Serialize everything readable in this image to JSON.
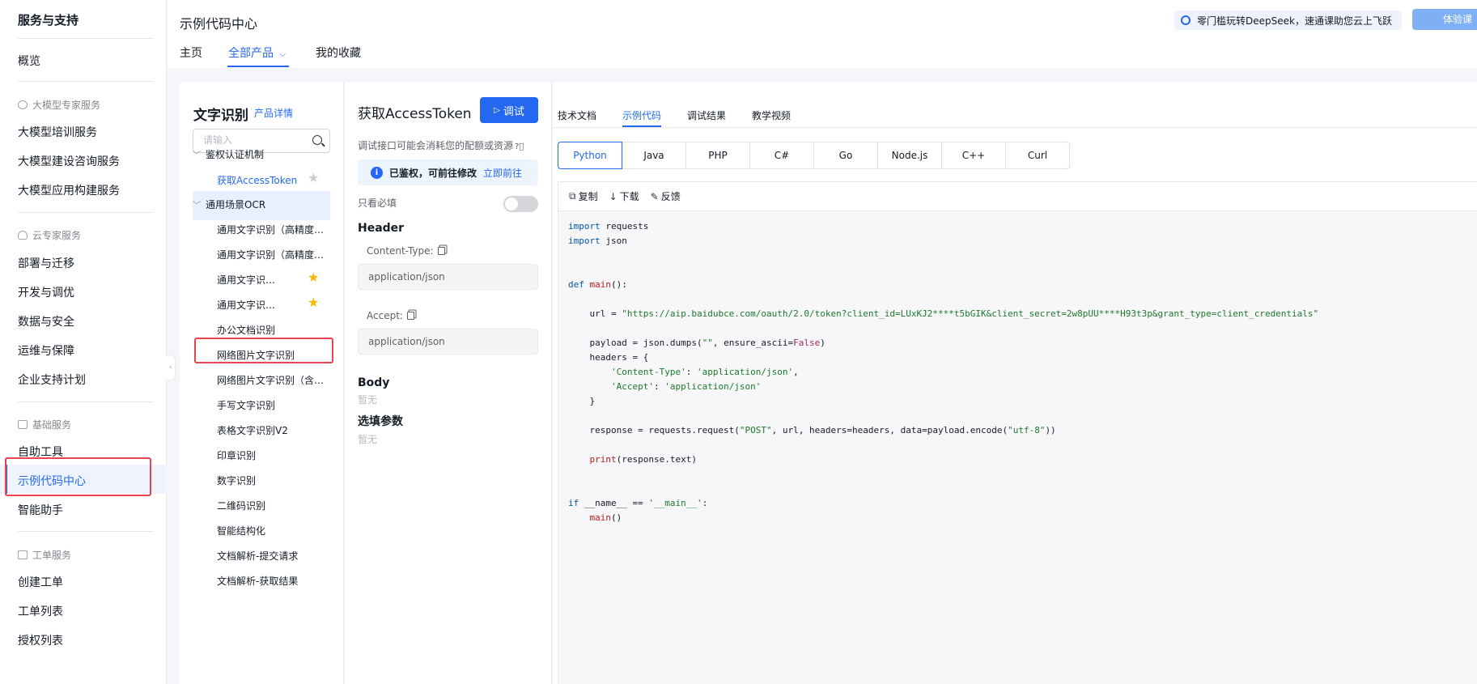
{
  "sidebar": {
    "title": "服务与支持",
    "overview": "概览",
    "groups": [
      {
        "label": "大模型专家服务",
        "items": [
          "大模型培训服务",
          "大模型建设咨询服务",
          "大模型应用构建服务"
        ]
      },
      {
        "label": "云专家服务",
        "items": [
          "部署与迁移",
          "开发与调优",
          "数据与安全",
          "运维与保障",
          "企业支持计划"
        ]
      },
      {
        "label": "基础服务",
        "items": [
          "自助工具",
          "示例代码中心",
          "智能助手"
        ]
      },
      {
        "label": "工单服务",
        "items": [
          "创建工单",
          "工单列表",
          "授权列表"
        ]
      }
    ],
    "active_item": "示例代码中心"
  },
  "header": {
    "title": "示例代码中心",
    "tabs": [
      "主页",
      "全部产品",
      "我的收藏"
    ],
    "active_tab": "全部产品",
    "promo": "零门槛玩转DeepSeek，速通课助您云上飞跃",
    "try_button": "体验课"
  },
  "product": {
    "title": "文字识别",
    "details_link": "产品详情",
    "search_placeholder": "请输入",
    "sections": [
      {
        "label": "鉴权认证机制",
        "items": [
          {
            "label": "获取AccessToken",
            "selected": true,
            "star": "off"
          }
        ]
      },
      {
        "label": "通用场景OCR",
        "items": [
          {
            "label": "通用文字识别（高精度含位置版）"
          },
          {
            "label": "通用文字识别（高精度版）"
          },
          {
            "label": "通用文字识别（标准含位置版）",
            "star": "on"
          },
          {
            "label": "通用文字识别（标准版）",
            "star": "on"
          },
          {
            "label": "办公文档识别"
          },
          {
            "label": "网络图片文字识别"
          },
          {
            "label": "网络图片文字识别（含位置版）"
          },
          {
            "label": "手写文字识别"
          },
          {
            "label": "表格文字识别V2"
          },
          {
            "label": "印章识别"
          },
          {
            "label": "数字识别"
          },
          {
            "label": "二维码识别"
          },
          {
            "label": "智能结构化"
          },
          {
            "label": "文档解析-提交请求"
          },
          {
            "label": "文档解析-获取结果"
          }
        ]
      }
    ]
  },
  "api": {
    "title": "获取AccessToken",
    "debug_button": "调试",
    "note": "调试接口可能会消耗您的配额或资源",
    "alert_text": "已鉴权，可前往修改",
    "alert_link": "立即前往",
    "required_only": "只看必填",
    "header_section": "Header",
    "fields": [
      {
        "label": "Content-Type:",
        "value": "application/json"
      },
      {
        "label": "Accept:",
        "value": "application/json"
      }
    ],
    "body_section": "Body",
    "body_empty": "暂无",
    "optional_section": "选填参数",
    "optional_empty": "暂无"
  },
  "code_panel": {
    "tabs": [
      "技术文档",
      "示例代码",
      "调试结果",
      "教学视频"
    ],
    "active_tab": "示例代码",
    "languages": [
      "Python",
      "Java",
      "PHP",
      "C#",
      "Go",
      "Node.js",
      "C++",
      "Curl"
    ],
    "active_language": "Python",
    "toolbar": {
      "copy": "复制",
      "download": "下载",
      "feedback": "反馈"
    },
    "code_lines": [
      "import requests",
      "import json",
      "",
      "",
      "def main():",
      "",
      "    url = \"https://aip.baidubce.com/oauth/2.0/token?client_id=LUxKJ2****t5bGIK&client_secret=2w8pUU****H93t3p&grant_type=client_credentials\"",
      "",
      "    payload = json.dumps(\"\", ensure_ascii=False)",
      "    headers = {",
      "        'Content-Type': 'application/json',",
      "        'Accept': 'application/json'",
      "    }",
      "",
      "    response = requests.request(\"POST\", url, headers=headers, data=payload.encode(\"utf-8\"))",
      "",
      "    print(response.text)",
      "",
      "",
      "if __name__ == '__main__':",
      "    main()"
    ]
  },
  "colors": {
    "accent": "#2468f2",
    "highlight_border": "#e8434e",
    "star": "#f5b800"
  }
}
